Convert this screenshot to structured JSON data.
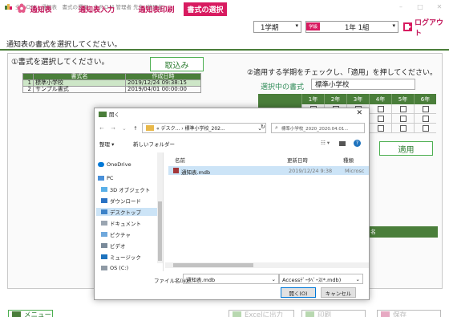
{
  "titlebar": {
    "text": "全ＲＯＭ - 通知表　書式の選択：全ＲＯＭ 管理者 先生 (管理者)",
    "min": "–",
    "max": "□",
    "close": "✕"
  },
  "menu": {
    "tsuchihyo": "通知表",
    "input": "通知表入力",
    "print": "通知表印刷",
    "select": "書式の選択"
  },
  "term_combo": "1学期",
  "class_tag": "学級",
  "class_combo": "1年 1組",
  "logout": "ログアウト",
  "page_title": "通知表の書式を選択してください。",
  "left": {
    "heading": "①書式を選択してください。",
    "import_button": "取込み",
    "table": {
      "headers": [
        "",
        "書式名",
        "作成日時"
      ],
      "rows": [
        {
          "no": "1",
          "name": "標準小学校",
          "date": "2019/12/24 09:38:15",
          "selected": true
        },
        {
          "no": "2",
          "name": "サンプル書式",
          "date": "2019/04/01 00:00:00",
          "selected": false
        }
      ]
    }
  },
  "right": {
    "heading": "②適用する学期をチェックし、「適用」を押してください。",
    "current_label": "選択中の書式",
    "current_value": "標準小学校",
    "grades": [
      "1年",
      "2年",
      "3年",
      "4年",
      "5年",
      "6年"
    ],
    "apply_button": "適用",
    "lower_header": "名"
  },
  "bottom": {
    "menu": "メニュー",
    "excel": "Excelに出力",
    "print": "印刷",
    "save": "保存"
  },
  "dialog": {
    "title": "開く",
    "close": "✕",
    "address": "« デスク... › 標準小学校_202...",
    "search_placeholder": "標準小学校_2020_2020.04.01...",
    "organize": "整理 ▾",
    "new_folder": "新しいフォルダー",
    "nav_items": [
      "OneDrive",
      "PC",
      "3D オブジェクト",
      "ダウンロード",
      "デスクトップ",
      "ドキュメント",
      "ピクチャ",
      "ビデオ",
      "ミュージック",
      "OS (C:)"
    ],
    "col_name": "名前",
    "col_date": "更新日時",
    "col_type": "種類",
    "file": {
      "name": "通知表.mdb",
      "date": "2019/12/24 9:38",
      "type": "Microsc"
    },
    "filename_label": "ファイル名(N):",
    "filename_value": "通知表.mdb",
    "filetype": "Accessﾃﾞｰﾀﾍﾞｰｽ(*.mdb)",
    "open_button": "開く(O)",
    "cancel_button": "キャンセル"
  }
}
